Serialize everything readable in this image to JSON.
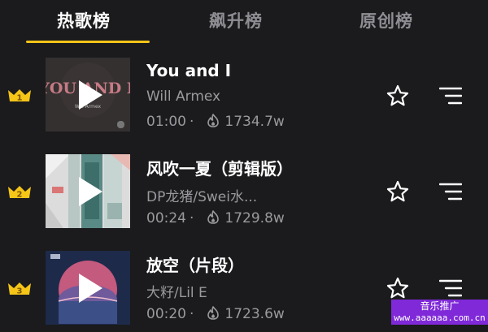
{
  "colors": {
    "background": "#1b1b1d",
    "accent": "#f5c518",
    "text_primary": "#ffffff",
    "text_secondary": "#9a9a9e",
    "promo": "#7f29d8"
  },
  "tabs": [
    {
      "label": "热歌榜",
      "active": true
    },
    {
      "label": "飙升榜",
      "active": false
    },
    {
      "label": "原创榜",
      "active": false
    }
  ],
  "songs": [
    {
      "rank": "1",
      "cover_text": "YOU AND I",
      "cover_subtext": "Will Armex",
      "title": "You and I",
      "artist": "Will Armex",
      "duration": "01:00",
      "dot": "·",
      "plays": "1734.7w",
      "rank_icon": "crown-icon",
      "play_icon": "play-icon",
      "fire_icon": "fire-icon",
      "favorite_icon": "star-outline-icon",
      "queue_icon": "add-to-playlist-icon"
    },
    {
      "rank": "2",
      "title": "风吹一夏（剪辑版）",
      "artist": "DP龙猪/Swei水...",
      "duration": "00:24",
      "dot": "·",
      "plays": "1729.8w",
      "rank_icon": "crown-icon",
      "play_icon": "play-icon",
      "fire_icon": "fire-icon",
      "favorite_icon": "star-outline-icon",
      "queue_icon": "add-to-playlist-icon"
    },
    {
      "rank": "3",
      "title": "放空（片段）",
      "artist": "大籽/Lil E",
      "duration": "00:20",
      "dot": "·",
      "plays": "1723.6w",
      "rank_icon": "crown-icon",
      "play_icon": "play-icon",
      "fire_icon": "fire-icon",
      "favorite_icon": "star-outline-icon",
      "queue_icon": "add-to-playlist-icon"
    }
  ],
  "watermark": {
    "title": "音乐推广",
    "url": "www.aaaaaa.com.cn"
  }
}
